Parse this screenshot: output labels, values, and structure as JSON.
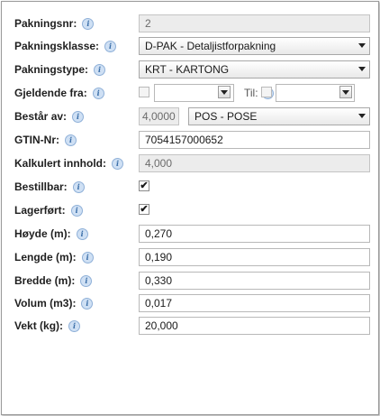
{
  "form": {
    "pakningsnr": {
      "label": "Pakningsnr:",
      "value": "2"
    },
    "pakningsklasse": {
      "label": "Pakningsklasse:",
      "value": "D-PAK - Detaljistforpakning"
    },
    "pakningstype": {
      "label": "Pakningstype:",
      "value": "KRT - KARTONG"
    },
    "gjeldende_fra": {
      "label": "Gjeldende fra:",
      "til_label": "Til:",
      "from_value": "",
      "to_value": ""
    },
    "bestar_av": {
      "label": "Består av:",
      "quantity": "4,0000",
      "unit": "POS - POSE"
    },
    "gtin": {
      "label": "GTIN-Nr:",
      "value": "7054157000652"
    },
    "kalkulert": {
      "label": "Kalkulert innhold:",
      "value": "4,000"
    },
    "bestillbar": {
      "label": "Bestillbar:",
      "checked_mark": "✔"
    },
    "lagerfort": {
      "label": "Lagerført:",
      "checked_mark": "✔"
    },
    "hoyde": {
      "label": "Høyde (m):",
      "value": "0,270"
    },
    "lengde": {
      "label": "Lengde (m):",
      "value": "0,190"
    },
    "bredde": {
      "label": "Bredde (m):",
      "value": "0,330"
    },
    "volum": {
      "label": "Volum (m3):",
      "value": "0,017"
    },
    "vekt": {
      "label": "Vekt (kg):",
      "value": "20,000"
    }
  },
  "icons": {
    "info": "i"
  }
}
